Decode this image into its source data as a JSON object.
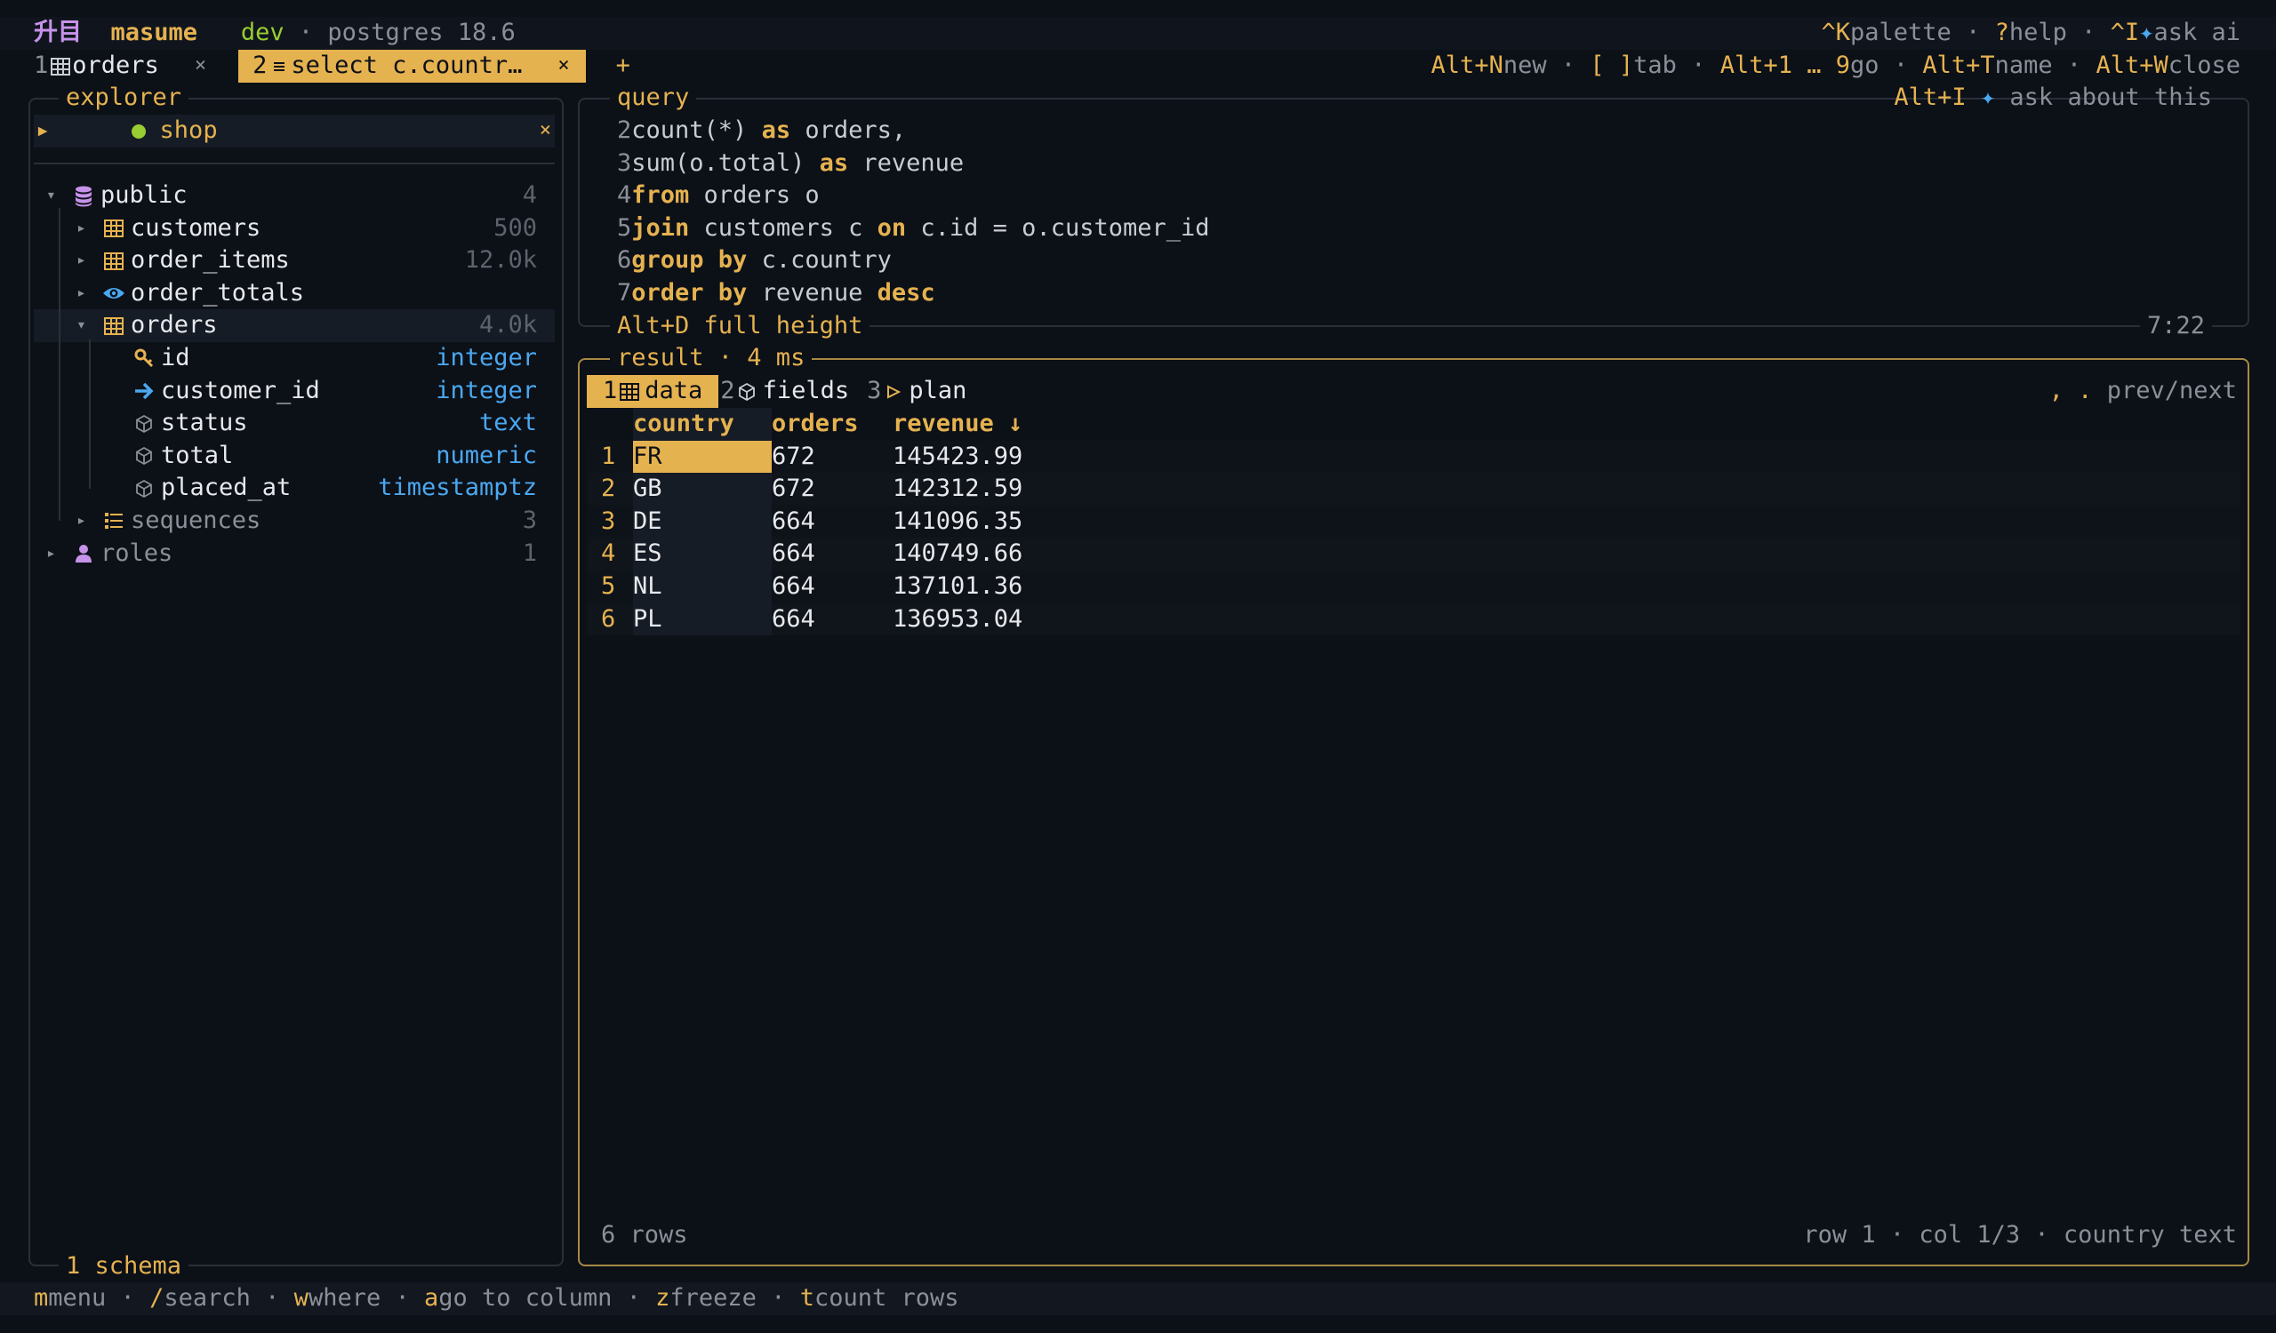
{
  "app": {
    "logo": "升目",
    "name": "masume",
    "env": "dev",
    "sep": "·",
    "db": "postgres 18.6"
  },
  "top_hints": [
    {
      "key": "^K",
      "label": "palette"
    },
    {
      "key": "?",
      "label": "help"
    },
    {
      "key": "^I",
      "label": "ask ai",
      "star": "✦"
    }
  ],
  "tabs": [
    {
      "num": "1",
      "icon": "table-icon",
      "label": "orders",
      "close": "×",
      "active": false
    },
    {
      "num": "2",
      "icon": "list-icon",
      "label": "select c.countr…",
      "close": "×",
      "active": true
    }
  ],
  "new_tab": "+",
  "tab_hints": [
    {
      "key": "Alt+N",
      "label": "new"
    },
    {
      "key": "[ ]",
      "label": "tab"
    },
    {
      "key": "Alt+1 … 9",
      "label": "go"
    },
    {
      "key": "Alt+T",
      "label": "name"
    },
    {
      "key": "Alt+W",
      "label": "close"
    }
  ],
  "explorer": {
    "title": "explorer",
    "connection": {
      "name": "shop",
      "close": "×"
    },
    "footer": "1 schema",
    "tree": [
      {
        "depth": 0,
        "arrow": "▾",
        "icon": "database-icon",
        "label": "public",
        "meta": "4"
      },
      {
        "depth": 1,
        "arrow": "▸",
        "icon": "table-icon",
        "label": "customers",
        "meta": "500"
      },
      {
        "depth": 1,
        "arrow": "▸",
        "icon": "table-icon",
        "label": "order_items",
        "meta": "12.0k"
      },
      {
        "depth": 1,
        "arrow": "▸",
        "icon": "view-icon",
        "label": "order_totals",
        "meta": ""
      },
      {
        "depth": 1,
        "arrow": "▾",
        "icon": "table-icon",
        "label": "orders",
        "meta": "4.0k",
        "selected": true
      },
      {
        "depth": 2,
        "arrow": "",
        "icon": "key-icon",
        "label": "id",
        "meta": "integer",
        "type": true
      },
      {
        "depth": 2,
        "arrow": "",
        "icon": "foreign-key-icon",
        "label": "customer_id",
        "meta": "integer",
        "type": true
      },
      {
        "depth": 2,
        "arrow": "",
        "icon": "column-icon",
        "label": "status",
        "meta": "text",
        "type": true
      },
      {
        "depth": 2,
        "arrow": "",
        "icon": "column-icon",
        "label": "total",
        "meta": "numeric",
        "type": true
      },
      {
        "depth": 2,
        "arrow": "",
        "icon": "column-icon",
        "label": "placed_at",
        "meta": "timestamptz",
        "type": true
      },
      {
        "depth": 1,
        "arrow": "▸",
        "icon": "sequence-icon",
        "label": "sequences",
        "meta": "3",
        "muted": true
      },
      {
        "depth": 0,
        "arrow": "▸",
        "icon": "role-icon",
        "label": "roles",
        "meta": "1",
        "muted": true
      }
    ]
  },
  "query": {
    "title": "query",
    "ask_hint": {
      "key": "Alt+I",
      "star": "✦",
      "label": "ask about this"
    },
    "lines": [
      {
        "n": "2",
        "parts": [
          [
            "w",
            "count(*) "
          ],
          [
            "k",
            "as"
          ],
          [
            "w",
            " orders,"
          ]
        ]
      },
      {
        "n": "3",
        "parts": [
          [
            "w",
            "sum(o.total) "
          ],
          [
            "k",
            "as"
          ],
          [
            "w",
            " revenue"
          ]
        ]
      },
      {
        "n": "4",
        "parts": [
          [
            "k",
            "from"
          ],
          [
            "w",
            " orders o"
          ]
        ]
      },
      {
        "n": "5",
        "parts": [
          [
            "k",
            "join"
          ],
          [
            "w",
            " customers c "
          ],
          [
            "k",
            "on"
          ],
          [
            "w",
            " c.id = o.customer_id"
          ]
        ]
      },
      {
        "n": "6",
        "parts": [
          [
            "k",
            "group by"
          ],
          [
            "w",
            " c.country"
          ]
        ]
      },
      {
        "n": "7",
        "parts": [
          [
            "k",
            "order by"
          ],
          [
            "w",
            " revenue "
          ],
          [
            "k",
            "desc"
          ]
        ]
      }
    ],
    "footer_hint": "Alt+D full height",
    "cursor": "7:22"
  },
  "result": {
    "title": "result · 4 ms",
    "tabs": [
      {
        "num": "1",
        "icon": "table-icon",
        "label": "data",
        "active": true
      },
      {
        "num": "2",
        "icon": "column-icon",
        "label": "fields",
        "active": false
      },
      {
        "num": "3",
        "icon": "play-icon",
        "label": "plan",
        "active": false
      }
    ],
    "nav_hint": {
      "key": ", .",
      "label": "prev/next"
    },
    "columns": [
      "country",
      "orders",
      "revenue ↓"
    ],
    "rows": [
      [
        "1",
        "FR",
        "672",
        "145423.99"
      ],
      [
        "2",
        "GB",
        "672",
        "142312.59"
      ],
      [
        "3",
        "DE",
        "664",
        "141096.35"
      ],
      [
        "4",
        "ES",
        "664",
        "140749.66"
      ],
      [
        "5",
        "NL",
        "664",
        "137101.36"
      ],
      [
        "6",
        "PL",
        "664",
        "136953.04"
      ]
    ],
    "row_count": "6 rows",
    "position": "row 1 · col 1/3 · country text"
  },
  "footer_hints": [
    {
      "key": "m",
      "label": "menu"
    },
    {
      "key": "/",
      "label": "search"
    },
    {
      "key": "w",
      "label": "where"
    },
    {
      "key": "a",
      "label": "go to column"
    },
    {
      "key": "z",
      "label": "freeze"
    },
    {
      "key": "t",
      "label": "count rows"
    }
  ],
  "colors": {
    "accent": "#e5b250",
    "blue": "#4aa8f0",
    "green": "#9acd32",
    "purple": "#c792ea",
    "background": "#0c1017"
  }
}
